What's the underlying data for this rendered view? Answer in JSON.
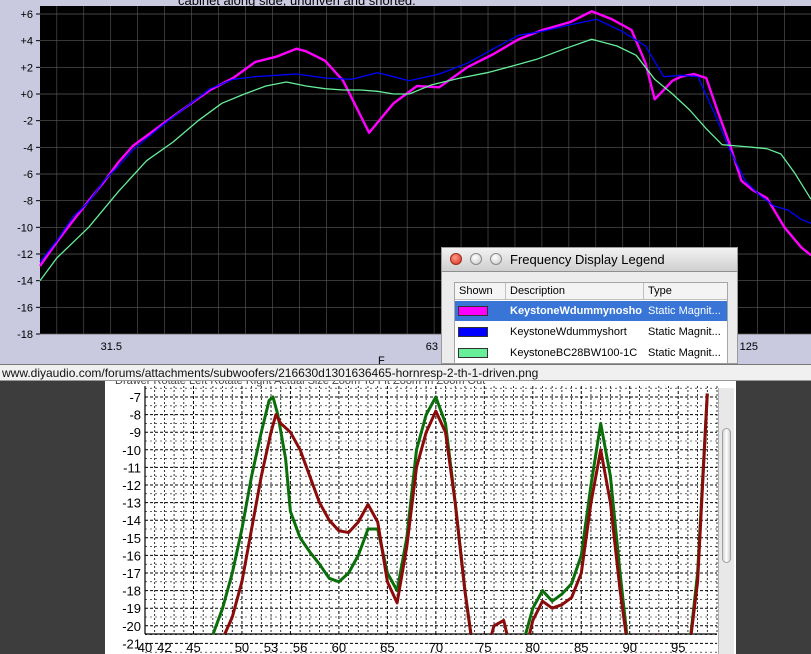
{
  "top_chart": {
    "caption_fragment": "cabinet along side, undriven and shorted.",
    "y_ticks": [
      "+6",
      "+4",
      "+2",
      "+0",
      "-2",
      "-4",
      "-6",
      "-8",
      "-10",
      "-12",
      "-14",
      "-16",
      "-18"
    ],
    "x_ticks": [
      "31.5",
      "63",
      "125"
    ],
    "x_axis_fragment": "F",
    "colors": {
      "bg": "#000000",
      "grid": "#5a5a5a",
      "s1": "#ff00ff",
      "s2": "#0000ff",
      "s3": "#66ee99"
    }
  },
  "legend": {
    "title": "Frequency Display Legend",
    "headers": {
      "shown": "Shown",
      "description": "Description",
      "type": "Type"
    },
    "rows": [
      {
        "color": "#ff00ff",
        "description": "KeystoneWdummynosho",
        "type": "Static Magnit...",
        "selected": true
      },
      {
        "color": "#0000ff",
        "description": "KeystoneWdummyshort",
        "type": "Static Magnit...",
        "selected": false
      },
      {
        "color": "#66ee99",
        "description": "KeystoneBC28BW100-1C",
        "type": "Static Magnit...",
        "selected": false
      }
    ]
  },
  "browser": {
    "url": "www.diyaudio.com/forums/attachments/subwoofers/216630d1301636465-hornresp-2-th-1-driven.png",
    "toolbar_fragment": "Drawer     Rotate Left   Rotate Right       Actual Size    Zoom To Fit    Zoom In    Zoom Out"
  },
  "bottom_chart": {
    "y_ticks": [
      "-7",
      "-8",
      "-9",
      "-10",
      "-11",
      "-12",
      "-13",
      "-14",
      "-15",
      "-16",
      "-17",
      "-18",
      "-19",
      "-20",
      "-21"
    ],
    "x_ticks": [
      "40",
      "42",
      "45",
      "50",
      "53",
      "56",
      "60",
      "65",
      "70",
      "75",
      "80",
      "85",
      "90",
      "95"
    ],
    "colors": {
      "bg": "#ffffff",
      "grid": "#000000",
      "green": "#0a6e0a",
      "red": "#8b0a0a"
    }
  },
  "chart_data": [
    {
      "type": "line",
      "x_scale": "log",
      "x_ticks": [
        31.5,
        63,
        125
      ],
      "xlim": [
        27,
        143
      ],
      "ylim": [
        -18,
        6.2
      ],
      "series": [
        {
          "name": "KeystoneWdummynosho",
          "color": "#ff00ff",
          "x": [
            27,
            28,
            29,
            30,
            31,
            32,
            33,
            35,
            37,
            39,
            41,
            43,
            45,
            47,
            48,
            50,
            52,
            55,
            58,
            61,
            64,
            68,
            72,
            76,
            80,
            85,
            89,
            93,
            97,
            100,
            102,
            104,
            106,
            108,
            111,
            114,
            117,
            120,
            123,
            126,
            130,
            135,
            140,
            143
          ],
          "y": [
            -12.9,
            -11.1,
            -9.5,
            -8.0,
            -6.6,
            -5.1,
            -3.9,
            -2.4,
            -1.0,
            0.3,
            1.2,
            2.4,
            2.8,
            3.4,
            3.2,
            2.5,
            1.0,
            -2.9,
            -0.7,
            0.6,
            0.5,
            2.0,
            3.0,
            4.1,
            4.8,
            5.4,
            6.2,
            5.6,
            4.8,
            2.3,
            -0.4,
            0.3,
            1.0,
            1.3,
            1.5,
            1.2,
            -1.4,
            -3.8,
            -6.5,
            -7.2,
            -7.8,
            -10.0,
            -11.5,
            -12.1
          ]
        },
        {
          "name": "KeystoneWdummyshort",
          "color": "#0000ff",
          "x": [
            27,
            28,
            29,
            30,
            31,
            32,
            33,
            35,
            37,
            39,
            41,
            43,
            45,
            47,
            50,
            53,
            56,
            60,
            64,
            68,
            72,
            76,
            80,
            85,
            90,
            95,
            100,
            104,
            108,
            112,
            116,
            120,
            124,
            128,
            132,
            136,
            140,
            143
          ],
          "y": [
            -12.6,
            -11.0,
            -9.2,
            -8.1,
            -6.5,
            -5.4,
            -4.2,
            -2.5,
            -1.0,
            0.4,
            1.1,
            1.3,
            1.4,
            1.5,
            1.2,
            1.1,
            1.6,
            1.0,
            1.5,
            2.3,
            3.4,
            4.4,
            4.7,
            5.2,
            5.6,
            4.7,
            3.6,
            1.3,
            1.4,
            1.3,
            -1.4,
            -4.2,
            -6.5,
            -7.6,
            -8.4,
            -8.7,
            -9.4,
            -9.7
          ]
        },
        {
          "name": "KeystoneBC28BW100-1C",
          "color": "#66ee99",
          "x": [
            27,
            28,
            30,
            32,
            34,
            36,
            38,
            40,
            42,
            44,
            46,
            48,
            50,
            52,
            54,
            56,
            58,
            60,
            63,
            67,
            71,
            75,
            79,
            84,
            89,
            94,
            98,
            102,
            106,
            110,
            114,
            118,
            122,
            126,
            130,
            134,
            138,
            143
          ],
          "y": [
            -14.0,
            -12.3,
            -10.0,
            -7.3,
            -5.0,
            -3.6,
            -2.0,
            -0.7,
            0.0,
            0.6,
            0.9,
            0.6,
            0.4,
            0.3,
            0.3,
            0.2,
            0.0,
            0.0,
            0.7,
            1.2,
            1.6,
            2.1,
            2.6,
            3.4,
            4.1,
            3.6,
            2.9,
            1.1,
            0.0,
            -1.2,
            -2.6,
            -3.8,
            -3.9,
            -4.0,
            -4.1,
            -4.5,
            -5.9,
            -7.9
          ]
        }
      ]
    },
    {
      "type": "line",
      "xlim": [
        40,
        99
      ],
      "ylim": [
        -22,
        -6.6
      ],
      "series": [
        {
          "color": "#0a6e0a",
          "x": [
            46,
            48,
            49,
            50,
            51,
            52,
            52.8,
            53.2,
            53.7,
            54.5,
            55,
            56,
            57,
            58,
            59,
            60,
            61,
            62,
            63,
            64,
            65,
            66,
            67,
            68,
            69,
            70,
            71,
            72,
            73,
            74,
            75,
            76,
            77,
            78,
            79,
            80,
            81,
            82,
            83,
            84,
            85,
            86,
            87,
            88,
            89,
            90,
            91,
            92,
            93,
            94,
            95,
            96,
            97,
            98
          ],
          "y": [
            -22,
            -19,
            -17,
            -14.5,
            -11.5,
            -9,
            -7.2,
            -7,
            -8,
            -10.5,
            -13.5,
            -15,
            -15.8,
            -16.5,
            -17.3,
            -17.5,
            -17,
            -16,
            -14.5,
            -14.5,
            -17,
            -18,
            -15,
            -10,
            -8,
            -7,
            -8.5,
            -13,
            -18,
            -22,
            -22,
            -21,
            -21.5,
            -22,
            -21,
            -19,
            -18,
            -18.6,
            -18.2,
            -17.6,
            -16,
            -12,
            -8.5,
            -11.5,
            -17,
            -22,
            -22,
            -22,
            -21,
            -21,
            -22,
            -22,
            -17,
            -6.8
          ]
        },
        {
          "color": "#8b0a0a",
          "x": [
            47,
            49,
            50,
            51,
            52,
            53,
            53.5,
            54,
            55,
            56,
            57,
            58,
            59,
            60,
            61,
            62,
            63,
            64,
            65,
            66,
            67,
            68,
            69,
            70,
            71,
            72,
            73,
            74,
            75,
            76,
            77,
            78,
            79,
            80,
            81,
            82,
            83,
            84,
            85,
            86,
            87,
            88,
            89,
            90,
            91,
            92,
            93,
            94,
            95,
            96,
            97,
            98
          ],
          "y": [
            -22,
            -19.5,
            -17.5,
            -14.5,
            -11.5,
            -9,
            -8,
            -8.5,
            -9,
            -10,
            -11.5,
            -13,
            -14,
            -14.6,
            -14.7,
            -14.1,
            -13.1,
            -14.1,
            -17.5,
            -18.7,
            -15.5,
            -11,
            -9,
            -7.8,
            -9,
            -13,
            -18,
            -22,
            -22,
            -20,
            -19.7,
            -22,
            -22,
            -19.7,
            -18.6,
            -19,
            -18.8,
            -18.4,
            -17,
            -13,
            -10,
            -13,
            -18,
            -22,
            -22,
            -22,
            -20.5,
            -21,
            -22,
            -22,
            -17.5,
            -6.8
          ]
        }
      ]
    }
  ]
}
